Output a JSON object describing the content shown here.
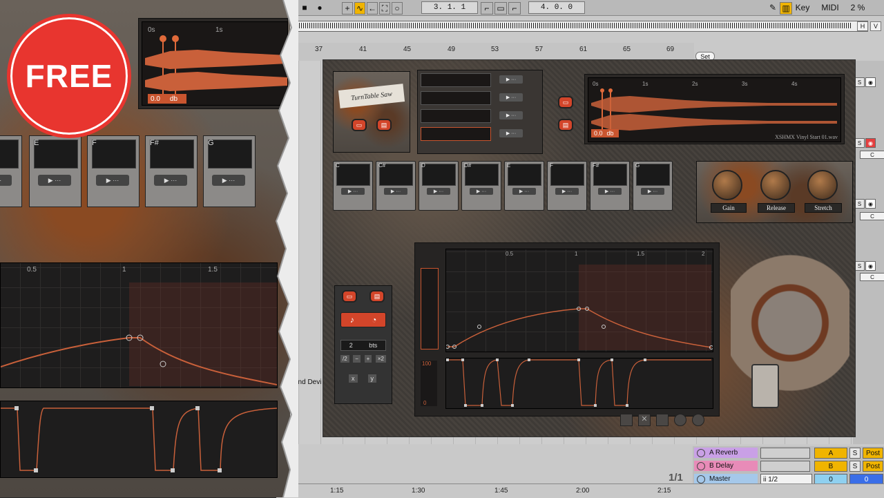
{
  "transport": {
    "position": "3.  1.  1",
    "loop_length": "4.  0.  0",
    "key_label": "Key",
    "midi_label": "MIDI",
    "cpu": "2 %",
    "h_label": "H",
    "v_label": "V"
  },
  "ruler": {
    "bars": [
      "37",
      "41",
      "45",
      "49",
      "53",
      "57",
      "61",
      "65",
      "69"
    ],
    "set_label": "Set"
  },
  "timeline": {
    "times": [
      "1:15",
      "1:30",
      "1:45",
      "2:00",
      "2:15"
    ],
    "page": "1/1"
  },
  "mixer": {
    "s_label": "S",
    "c_label": "C"
  },
  "returns": [
    {
      "name": "A Reverb",
      "letter": "A",
      "solo": "S",
      "post": "Post",
      "color": "#c9a0e6"
    },
    {
      "name": "B Delay",
      "letter": "B",
      "solo": "S",
      "post": "Post",
      "color": "#e88bb8"
    }
  ],
  "master": {
    "name": "Master",
    "select": "ii 1/2",
    "value_a": "0",
    "value_b": "0",
    "color": "#a5c8ea"
  },
  "left_clip_label": "and Devi",
  "badge": {
    "text": "FREE"
  },
  "plugin": {
    "logo": "TurnTable Saw",
    "waveform": {
      "times": [
        "0s",
        "1s",
        "2s",
        "3s",
        "4s"
      ],
      "gain_value": "0.0",
      "gain_unit": "db",
      "file": "XSHMX Vinyl Start 01.wav"
    },
    "keys": [
      "C",
      "C#",
      "D",
      "D#",
      "E",
      "F",
      "F#",
      "G"
    ],
    "knobs": [
      "Gain",
      "Release",
      "Stretch"
    ],
    "beats_value": "2",
    "beats_unit": "bts",
    "math_buttons": [
      "/2",
      "−",
      "+",
      "×2",
      "x",
      "y"
    ],
    "graph_ticks": [
      "0.5",
      "1",
      "1.5",
      "2"
    ],
    "level_top": "100",
    "level_bottom": "0"
  },
  "left": {
    "waveform_times": [
      "0s",
      "1s"
    ],
    "gain_value": "0.0",
    "gain_unit": "db",
    "keys": [
      "E",
      "F",
      "F#",
      "G"
    ],
    "graph_ticks": [
      "0.5",
      "1",
      "1.5"
    ]
  }
}
